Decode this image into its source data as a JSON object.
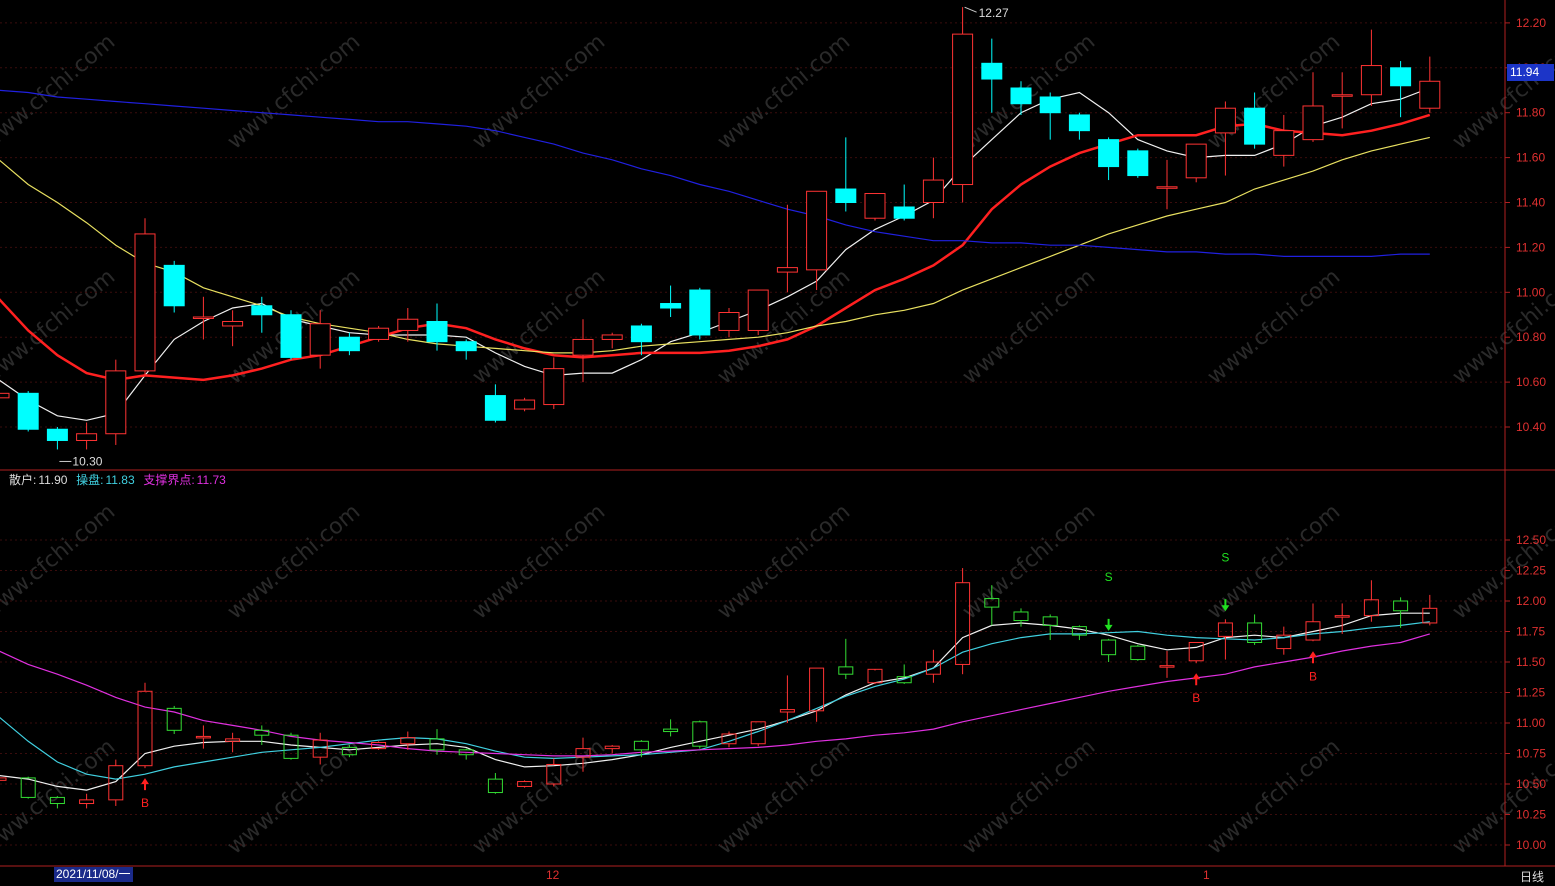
{
  "colors": {
    "up": "#ff3333",
    "down_top": "#00ffff",
    "down_bottom": "#33dd33",
    "ma_white": "#f0f0f0",
    "ma_red": "#ff2020",
    "ma_yellow": "#e8e060",
    "ma_blue": "#2020e0",
    "cyan_line": "#40d0e0",
    "magenta_line": "#e030e0",
    "axis": "#b02020"
  },
  "watermark": "www.cfchi.com",
  "top_panel": {
    "price_ticks": [
      "12.20",
      "12.00",
      "11.80",
      "11.60",
      "11.40",
      "11.20",
      "11.00",
      "10.80",
      "10.60",
      "10.40"
    ],
    "last_price_badge": "11.94",
    "high_annotation": "12.27",
    "low_annotation": "10.30"
  },
  "bottom_panel": {
    "legend": {
      "retail_label": "散户:",
      "retail_value": "11.90",
      "operator_label": "操盘:",
      "operator_value": "11.83",
      "support_label": "支撑界点:",
      "support_value": "11.73"
    },
    "price_ticks": [
      "12.50",
      "12.25",
      "12.00",
      "11.75",
      "11.50",
      "11.25",
      "11.00",
      "10.75",
      "10.50",
      "10.25",
      "10.00"
    ],
    "signals": [
      {
        "text": "B",
        "type": "buy",
        "index": 5
      },
      {
        "text": "S",
        "type": "sell",
        "index": 38
      },
      {
        "text": "B",
        "type": "buy",
        "index": 41
      },
      {
        "text": "S",
        "type": "sell",
        "index": 42
      },
      {
        "text": "B",
        "type": "buy",
        "index": 45
      }
    ]
  },
  "x_axis": {
    "date_label": "2021/11/08/一",
    "month_labels": [
      "12",
      "1"
    ],
    "period_label": "日线"
  },
  "chart_data": {
    "type": "candlestick",
    "title": "",
    "xlabel": "",
    "ylabel": "",
    "ylim_top": [
      10.3,
      12.27
    ],
    "ylim_bottom": [
      10.0,
      12.5
    ],
    "candles": [
      {
        "o": 10.53,
        "h": 10.6,
        "l": 10.4,
        "c": 10.55
      },
      {
        "o": 10.55,
        "h": 10.56,
        "l": 10.38,
        "c": 10.39
      },
      {
        "o": 10.39,
        "h": 10.4,
        "l": 10.3,
        "c": 10.34
      },
      {
        "o": 10.34,
        "h": 10.42,
        "l": 10.3,
        "c": 10.37
      },
      {
        "o": 10.37,
        "h": 10.7,
        "l": 10.32,
        "c": 10.65
      },
      {
        "o": 10.65,
        "h": 11.33,
        "l": 10.63,
        "c": 11.26
      },
      {
        "o": 11.12,
        "h": 11.14,
        "l": 10.91,
        "c": 10.94
      },
      {
        "o": 10.89,
        "h": 10.98,
        "l": 10.79,
        "c": 10.89
      },
      {
        "o": 10.85,
        "h": 10.92,
        "l": 10.76,
        "c": 10.87
      },
      {
        "o": 10.94,
        "h": 10.98,
        "l": 10.82,
        "c": 10.9
      },
      {
        "o": 10.9,
        "h": 10.92,
        "l": 10.7,
        "c": 10.71
      },
      {
        "o": 10.72,
        "h": 10.92,
        "l": 10.66,
        "c": 10.86
      },
      {
        "o": 10.8,
        "h": 10.82,
        "l": 10.72,
        "c": 10.74
      },
      {
        "o": 10.79,
        "h": 10.85,
        "l": 10.78,
        "c": 10.84
      },
      {
        "o": 10.83,
        "h": 10.93,
        "l": 10.78,
        "c": 10.88
      },
      {
        "o": 10.87,
        "h": 10.95,
        "l": 10.74,
        "c": 10.78
      },
      {
        "o": 10.78,
        "h": 10.79,
        "l": 10.7,
        "c": 10.74
      },
      {
        "o": 10.54,
        "h": 10.59,
        "l": 10.42,
        "c": 10.43
      },
      {
        "o": 10.48,
        "h": 10.53,
        "l": 10.47,
        "c": 10.52
      },
      {
        "o": 10.5,
        "h": 10.71,
        "l": 10.48,
        "c": 10.66
      },
      {
        "o": 10.72,
        "h": 10.88,
        "l": 10.6,
        "c": 10.79
      },
      {
        "o": 10.79,
        "h": 10.82,
        "l": 10.75,
        "c": 10.81
      },
      {
        "o": 10.85,
        "h": 10.86,
        "l": 10.72,
        "c": 10.78
      },
      {
        "o": 10.95,
        "h": 11.03,
        "l": 10.89,
        "c": 10.93
      },
      {
        "o": 11.01,
        "h": 11.02,
        "l": 10.79,
        "c": 10.81
      },
      {
        "o": 10.83,
        "h": 10.93,
        "l": 10.8,
        "c": 10.91
      },
      {
        "o": 10.83,
        "h": 11.01,
        "l": 10.81,
        "c": 11.01
      },
      {
        "o": 11.09,
        "h": 11.39,
        "l": 11.0,
        "c": 11.11
      },
      {
        "o": 11.1,
        "h": 11.45,
        "l": 11.01,
        "c": 11.45
      },
      {
        "o": 11.46,
        "h": 11.69,
        "l": 11.36,
        "c": 11.4
      },
      {
        "o": 11.33,
        "h": 11.43,
        "l": 11.32,
        "c": 11.44
      },
      {
        "o": 11.38,
        "h": 11.48,
        "l": 11.32,
        "c": 11.33
      },
      {
        "o": 11.4,
        "h": 11.6,
        "l": 11.33,
        "c": 11.5
      },
      {
        "o": 11.48,
        "h": 12.27,
        "l": 11.4,
        "c": 12.15
      },
      {
        "o": 12.02,
        "h": 12.13,
        "l": 11.8,
        "c": 11.95
      },
      {
        "o": 11.91,
        "h": 11.94,
        "l": 11.79,
        "c": 11.84
      },
      {
        "o": 11.87,
        "h": 11.89,
        "l": 11.68,
        "c": 11.8
      },
      {
        "o": 11.79,
        "h": 11.8,
        "l": 11.68,
        "c": 11.72
      },
      {
        "o": 11.68,
        "h": 11.69,
        "l": 11.5,
        "c": 11.56
      },
      {
        "o": 11.63,
        "h": 11.64,
        "l": 11.51,
        "c": 11.52
      },
      {
        "o": 11.47,
        "h": 11.59,
        "l": 11.37,
        "c": 11.47
      },
      {
        "o": 11.51,
        "h": 11.66,
        "l": 11.49,
        "c": 11.66
      },
      {
        "o": 11.71,
        "h": 11.85,
        "l": 11.52,
        "c": 11.82
      },
      {
        "o": 11.82,
        "h": 11.89,
        "l": 11.64,
        "c": 11.66
      },
      {
        "o": 11.61,
        "h": 11.79,
        "l": 11.56,
        "c": 11.72
      },
      {
        "o": 11.68,
        "h": 11.98,
        "l": 11.67,
        "c": 11.83
      },
      {
        "o": 11.88,
        "h": 11.98,
        "l": 11.73,
        "c": 11.88
      },
      {
        "o": 11.88,
        "h": 12.17,
        "l": 11.83,
        "c": 12.01
      },
      {
        "o": 12.0,
        "h": 12.03,
        "l": 11.78,
        "c": 11.92
      },
      {
        "o": 11.82,
        "h": 12.05,
        "l": 11.8,
        "c": 11.94
      }
    ],
    "series": [
      {
        "panel": "top",
        "color": "ma_white",
        "values": [
          10.61,
          10.52,
          10.45,
          10.43,
          10.46,
          10.63,
          10.79,
          10.87,
          10.93,
          10.95,
          10.88,
          10.85,
          10.82,
          10.81,
          10.81,
          10.81,
          10.8,
          10.73,
          10.67,
          10.63,
          10.64,
          10.64,
          10.7,
          10.78,
          10.82,
          10.87,
          10.92,
          10.98,
          11.05,
          11.19,
          11.28,
          11.34,
          11.41,
          11.56,
          11.68,
          11.8,
          11.86,
          11.89,
          11.8,
          11.68,
          11.63,
          11.6,
          11.61,
          11.61,
          11.66,
          11.74,
          11.78,
          11.84,
          11.86,
          11.91
        ]
      },
      {
        "panel": "top",
        "color": "ma_red",
        "values": [
          10.97,
          10.83,
          10.72,
          10.64,
          10.61,
          10.63,
          10.62,
          10.61,
          10.63,
          10.66,
          10.7,
          10.72,
          10.76,
          10.8,
          10.84,
          10.86,
          10.84,
          10.79,
          10.75,
          10.72,
          10.71,
          10.72,
          10.73,
          10.73,
          10.73,
          10.74,
          10.76,
          10.79,
          10.85,
          10.93,
          11.01,
          11.06,
          11.12,
          11.21,
          11.37,
          11.48,
          11.56,
          11.62,
          11.66,
          11.7,
          11.7,
          11.7,
          11.74,
          11.75,
          11.72,
          11.71,
          11.7,
          11.72,
          11.75,
          11.79
        ]
      },
      {
        "panel": "top",
        "color": "ma_yellow",
        "values": [
          11.59,
          11.48,
          11.4,
          11.31,
          11.21,
          11.13,
          11.09,
          11.02,
          10.98,
          10.94,
          10.89,
          10.86,
          10.84,
          10.82,
          10.79,
          10.77,
          10.76,
          10.75,
          10.74,
          10.73,
          10.73,
          10.74,
          10.76,
          10.77,
          10.78,
          10.79,
          10.8,
          10.82,
          10.85,
          10.87,
          10.9,
          10.92,
          10.95,
          11.01,
          11.06,
          11.11,
          11.16,
          11.21,
          11.26,
          11.3,
          11.34,
          11.37,
          11.4,
          11.46,
          11.5,
          11.54,
          11.59,
          11.63,
          11.66,
          11.69
        ]
      },
      {
        "panel": "top",
        "color": "ma_blue",
        "values": [
          11.9,
          11.89,
          11.87,
          11.86,
          11.85,
          11.84,
          11.83,
          11.82,
          11.81,
          11.8,
          11.79,
          11.78,
          11.77,
          11.76,
          11.76,
          11.75,
          11.74,
          11.72,
          11.69,
          11.66,
          11.62,
          11.59,
          11.55,
          11.52,
          11.48,
          11.45,
          11.41,
          11.37,
          11.34,
          11.3,
          11.27,
          11.25,
          11.23,
          11.23,
          11.22,
          11.22,
          11.21,
          11.21,
          11.2,
          11.19,
          11.18,
          11.18,
          11.17,
          11.17,
          11.16,
          11.16,
          11.16,
          11.16,
          11.17,
          11.17
        ]
      },
      {
        "panel": "bottom",
        "name": "散户",
        "color": "ma_white",
        "values": [
          10.57,
          10.54,
          10.48,
          10.45,
          10.52,
          10.75,
          10.81,
          10.84,
          10.85,
          10.85,
          10.82,
          10.8,
          10.78,
          10.8,
          10.82,
          10.83,
          10.8,
          10.7,
          10.64,
          10.65,
          10.67,
          10.7,
          10.74,
          10.8,
          10.85,
          10.9,
          10.95,
          11.02,
          11.1,
          11.23,
          11.33,
          11.37,
          11.45,
          11.7,
          11.8,
          11.82,
          11.8,
          11.77,
          11.72,
          11.65,
          11.6,
          11.62,
          11.7,
          11.72,
          11.7,
          11.75,
          11.8,
          11.88,
          11.9,
          11.9
        ]
      },
      {
        "panel": "bottom",
        "name": "操盘",
        "color": "cyan_line",
        "values": [
          11.05,
          10.85,
          10.68,
          10.58,
          10.54,
          10.58,
          10.64,
          10.68,
          10.72,
          10.76,
          10.78,
          10.8,
          10.83,
          10.86,
          10.88,
          10.87,
          10.83,
          10.77,
          10.72,
          10.71,
          10.72,
          10.73,
          10.74,
          10.76,
          10.78,
          10.85,
          10.93,
          11.02,
          11.12,
          11.22,
          11.3,
          11.36,
          11.45,
          11.58,
          11.65,
          11.7,
          11.73,
          11.73,
          11.74,
          11.75,
          11.72,
          11.7,
          11.69,
          11.68,
          11.7,
          11.73,
          11.75,
          11.78,
          11.8,
          11.83
        ]
      },
      {
        "panel": "bottom",
        "name": "支撑界点",
        "color": "magenta_line",
        "values": [
          11.59,
          11.48,
          11.4,
          11.31,
          11.21,
          11.13,
          11.09,
          11.02,
          10.98,
          10.94,
          10.89,
          10.86,
          10.84,
          10.82,
          10.79,
          10.77,
          10.76,
          10.75,
          10.74,
          10.73,
          10.73,
          10.74,
          10.76,
          10.77,
          10.78,
          10.79,
          10.8,
          10.82,
          10.85,
          10.87,
          10.9,
          10.92,
          10.95,
          11.01,
          11.06,
          11.11,
          11.16,
          11.21,
          11.26,
          11.3,
          11.34,
          11.37,
          11.4,
          11.46,
          11.5,
          11.54,
          11.59,
          11.63,
          11.66,
          11.73
        ]
      }
    ]
  }
}
